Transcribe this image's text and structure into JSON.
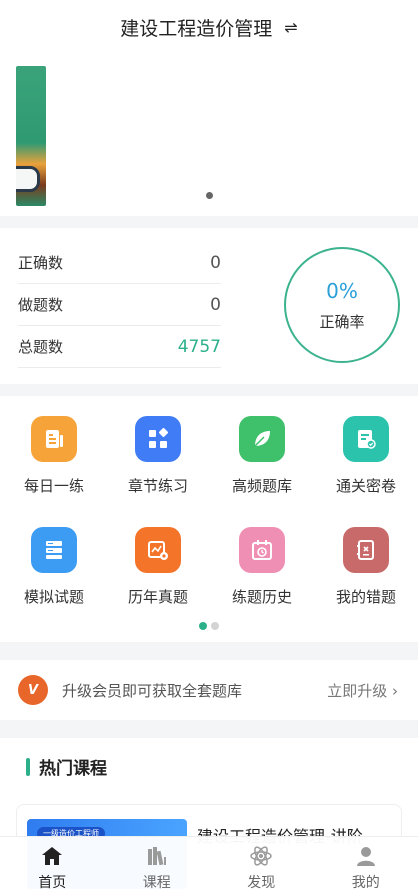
{
  "header": {
    "title": "建设工程造价管理",
    "switch_icon": "swap-icon"
  },
  "banner": {
    "slides_total": 1,
    "active_slide": 1
  },
  "stats": {
    "rows": [
      {
        "label": "正确数",
        "value": "0"
      },
      {
        "label": "做题数",
        "value": "0"
      },
      {
        "label": "总题数",
        "value": "4757"
      }
    ],
    "accuracy_value": "0%",
    "accuracy_label": "正确率"
  },
  "features": {
    "items": [
      {
        "label": "每日一练",
        "icon": "daily-practice-icon",
        "color": "#f6a43a"
      },
      {
        "label": "章节练习",
        "icon": "chapter-practice-icon",
        "color": "#3f7cf5"
      },
      {
        "label": "高频题库",
        "icon": "leaf-icon",
        "color": "#3fc06b"
      },
      {
        "label": "通关密卷",
        "icon": "secret-paper-icon",
        "color": "#2cc3ac"
      },
      {
        "label": "模拟试题",
        "icon": "mock-exam-icon",
        "color": "#3c9bf2"
      },
      {
        "label": "历年真题",
        "icon": "past-exam-icon",
        "color": "#f4742a"
      },
      {
        "label": "练题历史",
        "icon": "calendar-history-icon",
        "color": "#f08fb4"
      },
      {
        "label": "我的错题",
        "icon": "wrong-questions-icon",
        "color": "#c96a6a"
      }
    ],
    "pages_total": 2,
    "active_page": 1
  },
  "vip": {
    "badge": "VIP",
    "text": "升级会员即可获取全套题库",
    "action": "立即升级"
  },
  "courses": {
    "section_title": "热门课程",
    "items": [
      {
        "title": "建设工程造价管理-讲阶",
        "thumb_tag": "一级造价工程师"
      }
    ]
  },
  "tabbar": {
    "tabs": [
      {
        "label": "首页",
        "icon": "home-icon",
        "active": true
      },
      {
        "label": "课程",
        "icon": "books-icon",
        "active": false
      },
      {
        "label": "发现",
        "icon": "atom-icon",
        "active": false
      },
      {
        "label": "我的",
        "icon": "user-icon",
        "active": false
      }
    ]
  },
  "colors": {
    "accent": "#2bb08a",
    "ring_text": "#2b9fd8",
    "vip": "#e8662a"
  }
}
